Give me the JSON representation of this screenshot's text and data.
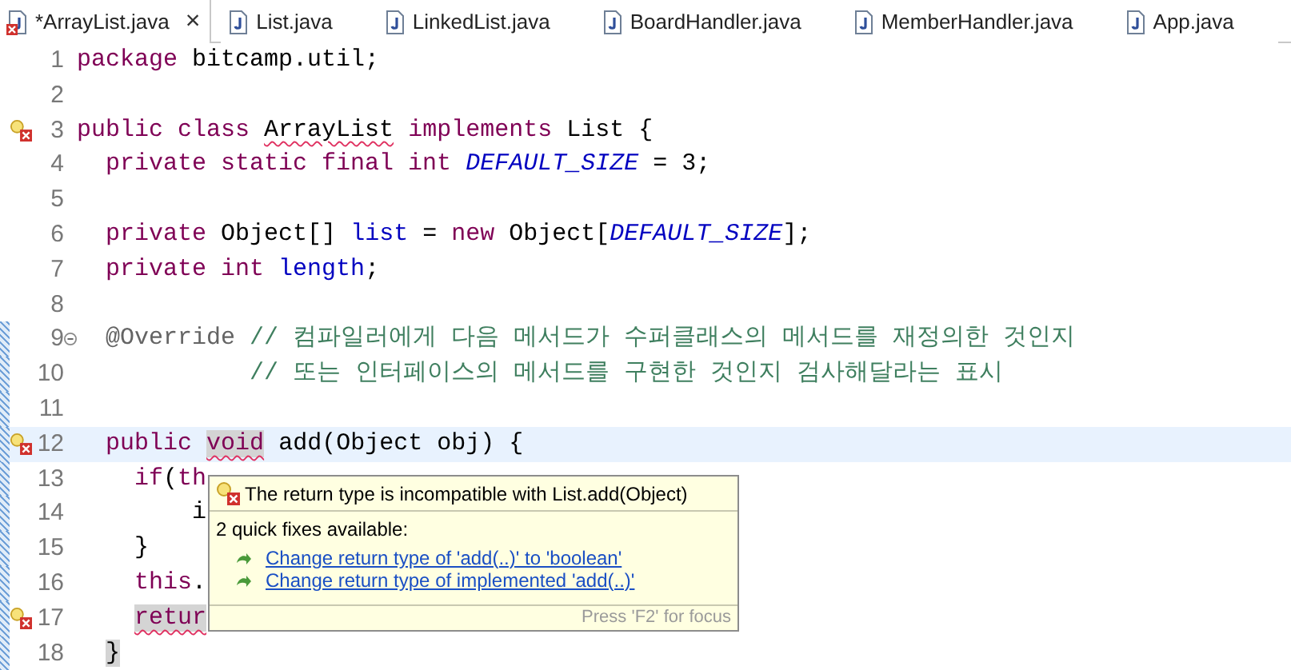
{
  "tabs": [
    {
      "label": "*ArrayList.java",
      "selected": true,
      "error": true,
      "close": "×"
    },
    {
      "label": "List.java",
      "selected": false,
      "error": false
    },
    {
      "label": "LinkedList.java",
      "selected": false,
      "error": false
    },
    {
      "label": "BoardHandler.java",
      "selected": false,
      "error": false
    },
    {
      "label": "MemberHandler.java",
      "selected": false,
      "error": false
    },
    {
      "label": "App.java",
      "selected": false,
      "error": false
    }
  ],
  "lines": [
    {
      "number": "1",
      "error": false,
      "fold": false,
      "changed": false,
      "current": false,
      "tokens": [
        {
          "text": "package",
          "kind": "keyword"
        },
        {
          "text": " bitcamp.util;",
          "kind": "plain"
        }
      ]
    },
    {
      "number": "2",
      "error": false,
      "fold": false,
      "changed": false,
      "current": false
    },
    {
      "number": "3",
      "error": true,
      "fold": false,
      "changed": false,
      "current": false,
      "tokens": [
        {
          "text": "public class ",
          "kind": "keyword"
        },
        {
          "text": "ArrayList",
          "kind": "plain",
          "squiggle": true
        },
        {
          "text": " implements",
          "kind": "keyword"
        },
        {
          "text": " List {",
          "kind": "plain"
        }
      ]
    },
    {
      "number": "4",
      "error": false,
      "fold": false,
      "changed": false,
      "current": false,
      "tokens": [
        {
          "text": "  private static final int ",
          "kind": "keyword"
        },
        {
          "text": "DEFAULT_SIZE",
          "kind": "constant"
        },
        {
          "text": " = 3;",
          "kind": "plain"
        }
      ]
    },
    {
      "number": "5",
      "error": false,
      "fold": false,
      "changed": false,
      "current": false
    },
    {
      "number": "6",
      "error": false,
      "fold": false,
      "changed": false,
      "current": false,
      "tokens": [
        {
          "text": "  private",
          "kind": "keyword"
        },
        {
          "text": " Object[] ",
          "kind": "plain"
        },
        {
          "text": "list",
          "kind": "field"
        },
        {
          "text": " = ",
          "kind": "plain"
        },
        {
          "text": "new",
          "kind": "keyword"
        },
        {
          "text": " Object[",
          "kind": "plain"
        },
        {
          "text": "DEFAULT_SIZE",
          "kind": "constant"
        },
        {
          "text": "];",
          "kind": "plain"
        }
      ]
    },
    {
      "number": "7",
      "error": false,
      "fold": false,
      "changed": false,
      "current": false,
      "tokens": [
        {
          "text": "  private int ",
          "kind": "keyword"
        },
        {
          "text": "length",
          "kind": "field"
        },
        {
          "text": ";",
          "kind": "plain"
        }
      ]
    },
    {
      "number": "8",
      "error": false,
      "fold": false,
      "changed": false,
      "current": false
    },
    {
      "number": "9",
      "error": false,
      "fold": true,
      "changed": true,
      "current": false,
      "tokens": [
        {
          "text": "  @Override ",
          "kind": "annotation"
        },
        {
          "text": "// 컴파일러에게 다음 메서드가 수퍼클래스의 메서드를 재정의한 것인지",
          "kind": "comment"
        }
      ]
    },
    {
      "number": "10",
      "error": false,
      "fold": false,
      "changed": true,
      "current": false,
      "tokens": [
        {
          "text": "            // 또는 인터페이스의 메서드를 구현한 것인지 검사해달라는 표시",
          "kind": "comment"
        }
      ]
    },
    {
      "number": "11",
      "error": false,
      "fold": false,
      "changed": true,
      "current": false
    },
    {
      "number": "12",
      "error": true,
      "fold": false,
      "changed": true,
      "current": true,
      "tokens": [
        {
          "text": "  public ",
          "kind": "keyword"
        },
        {
          "text": "void",
          "kind": "keyword",
          "squiggle": true,
          "occurrence": true
        },
        {
          "text": " add(Object obj) {",
          "kind": "plain"
        }
      ]
    },
    {
      "number": "13",
      "error": false,
      "fold": false,
      "changed": true,
      "current": false,
      "tokens": [
        {
          "text": "    if",
          "kind": "keyword"
        },
        {
          "text": "(",
          "kind": "plain"
        },
        {
          "text": "th",
          "kind": "keyword"
        }
      ]
    },
    {
      "number": "14",
      "error": false,
      "fold": false,
      "changed": true,
      "current": false,
      "tokens": [
        {
          "text": "        i",
          "kind": "plain"
        }
      ]
    },
    {
      "number": "15",
      "error": false,
      "fold": false,
      "changed": true,
      "current": false,
      "tokens": [
        {
          "text": "    }",
          "kind": "plain"
        }
      ]
    },
    {
      "number": "16",
      "error": false,
      "fold": false,
      "changed": true,
      "current": false,
      "tokens": [
        {
          "text": "    this",
          "kind": "keyword"
        },
        {
          "text": ".",
          "kind": "plain"
        }
      ]
    },
    {
      "number": "17",
      "error": true,
      "fold": false,
      "changed": true,
      "current": false,
      "tokens": [
        {
          "text": "    retur",
          "kind": "keyword",
          "squiggle": true,
          "occurrence": true
        }
      ]
    },
    {
      "number": "18",
      "error": false,
      "fold": false,
      "changed": true,
      "current": false,
      "tokens": [
        {
          "text": "  }",
          "kind": "plain",
          "occurrence": true
        }
      ]
    }
  ],
  "popup": {
    "message": "The return type is incompatible with List.add(Object)",
    "summary": "2 quick fixes available:",
    "fixes": [
      "Change return type of 'add(..)' to 'boolean'",
      "Change return type of implemented 'add(..)'"
    ],
    "footer": "Press 'F2' for focus"
  }
}
